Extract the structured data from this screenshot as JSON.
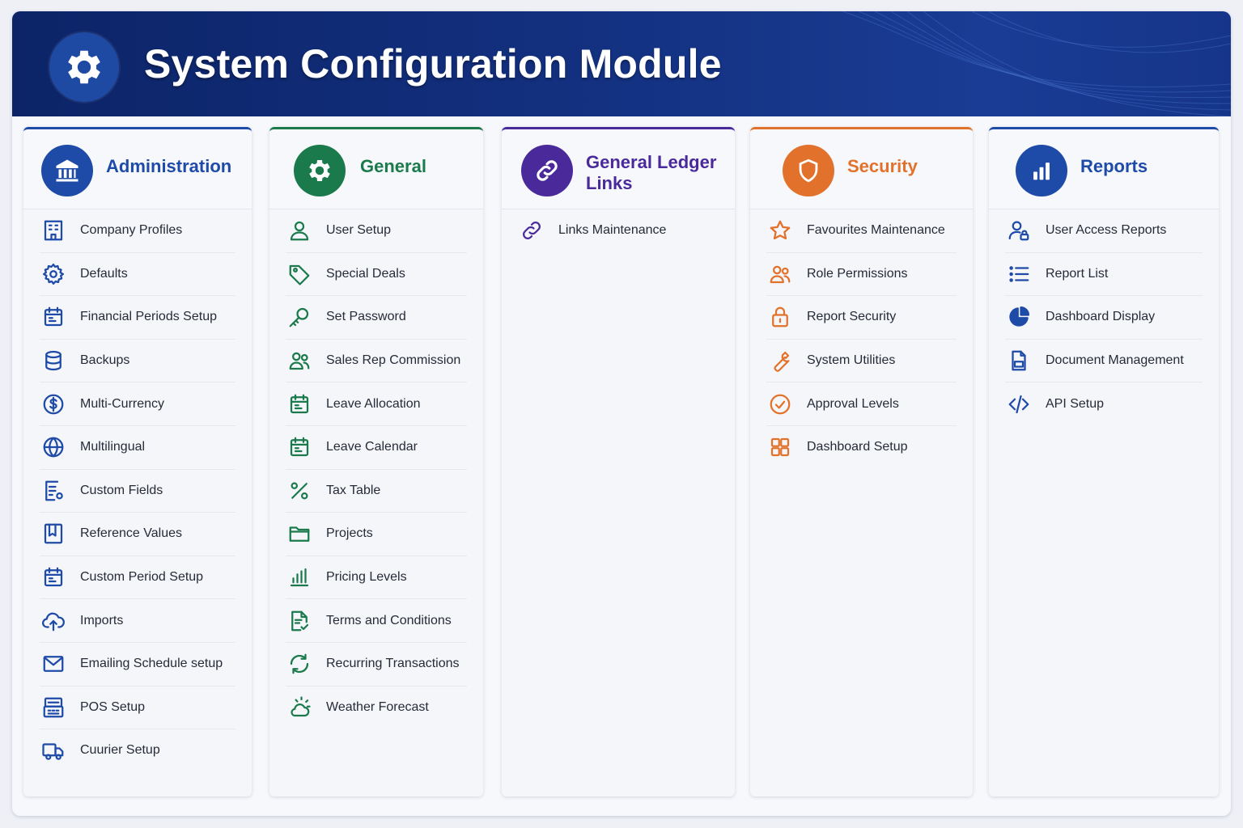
{
  "header": {
    "title": "System Configuration Module",
    "icon": "gear-icon"
  },
  "colors": {
    "header_bg": "#13307f",
    "administration": "#1e4aa8",
    "general": "#1a7a4c",
    "general_ledger": "#4a2a9a",
    "security": "#e2722b",
    "reports": "#1e4aa8"
  },
  "columns": [
    {
      "key": "administration",
      "title": "Administration",
      "icon": "bank-icon",
      "items": [
        {
          "label": "Company Profiles",
          "icon": "building-icon"
        },
        {
          "label": "Defaults",
          "icon": "cog-icon"
        },
        {
          "label": "Financial Periods Setup",
          "icon": "calendar-icon"
        },
        {
          "label": "Backups",
          "icon": "database-icon"
        },
        {
          "label": "Multi-Currency",
          "icon": "dollar-icon"
        },
        {
          "label": "Multilingual",
          "icon": "globe-icon"
        },
        {
          "label": "Custom Fields",
          "icon": "form-icon"
        },
        {
          "label": "Reference Values",
          "icon": "bookmark-icon"
        },
        {
          "label": "Custom Period Setup",
          "icon": "calendar-icon"
        },
        {
          "label": "Imports",
          "icon": "cloud-upload-icon"
        },
        {
          "label": "Emailing Schedule setup",
          "icon": "mail-icon"
        },
        {
          "label": "POS Setup",
          "icon": "register-icon"
        },
        {
          "label": "Cuurier Setup",
          "icon": "truck-icon"
        }
      ]
    },
    {
      "key": "general",
      "title": "General",
      "icon": "gear-icon",
      "items": [
        {
          "label": "User Setup",
          "icon": "user-icon"
        },
        {
          "label": "Special Deals",
          "icon": "tag-icon"
        },
        {
          "label": "Set Password",
          "icon": "key-icon"
        },
        {
          "label": "Sales Rep Commission",
          "icon": "users-icon"
        },
        {
          "label": "Leave Allocation",
          "icon": "calendar-icon"
        },
        {
          "label": "Leave Calendar",
          "icon": "calendar-icon"
        },
        {
          "label": "Tax Table",
          "icon": "percent-icon"
        },
        {
          "label": "Projects",
          "icon": "folder-icon"
        },
        {
          "label": "Pricing Levels",
          "icon": "bar-chart-icon"
        },
        {
          "label": "Terms and Conditions",
          "icon": "document-check-icon"
        },
        {
          "label": "Recurring Transactions",
          "icon": "refresh-icon"
        },
        {
          "label": "Weather Forecast",
          "icon": "weather-icon"
        }
      ]
    },
    {
      "key": "general_ledger",
      "title": "General Ledger Links",
      "title_line1": "General Ledger",
      "title_line2": "Links",
      "icon": "link-icon",
      "items": [
        {
          "label": "Links Maintenance",
          "icon": "link-icon"
        }
      ]
    },
    {
      "key": "security",
      "title": "Security",
      "icon": "shield-icon",
      "items": [
        {
          "label": "Favourites Maintenance",
          "icon": "star-icon"
        },
        {
          "label": "Role Permissions",
          "icon": "users-icon"
        },
        {
          "label": "Report Security",
          "icon": "lock-icon"
        },
        {
          "label": "System Utilities",
          "icon": "wrench-icon"
        },
        {
          "label": "Approval Levels",
          "icon": "check-circle-icon"
        },
        {
          "label": "Dashboard Setup",
          "icon": "grid-icon"
        }
      ]
    },
    {
      "key": "reports",
      "title": "Reports",
      "icon": "bar-chart-icon",
      "items": [
        {
          "label": "User Access Reports",
          "icon": "user-lock-icon"
        },
        {
          "label": "Report List",
          "icon": "list-icon"
        },
        {
          "label": "Dashboard Display",
          "icon": "pie-chart-icon"
        },
        {
          "label": "Document Management",
          "icon": "file-icon"
        },
        {
          "label": "API Setup",
          "icon": "code-icon"
        }
      ]
    }
  ]
}
